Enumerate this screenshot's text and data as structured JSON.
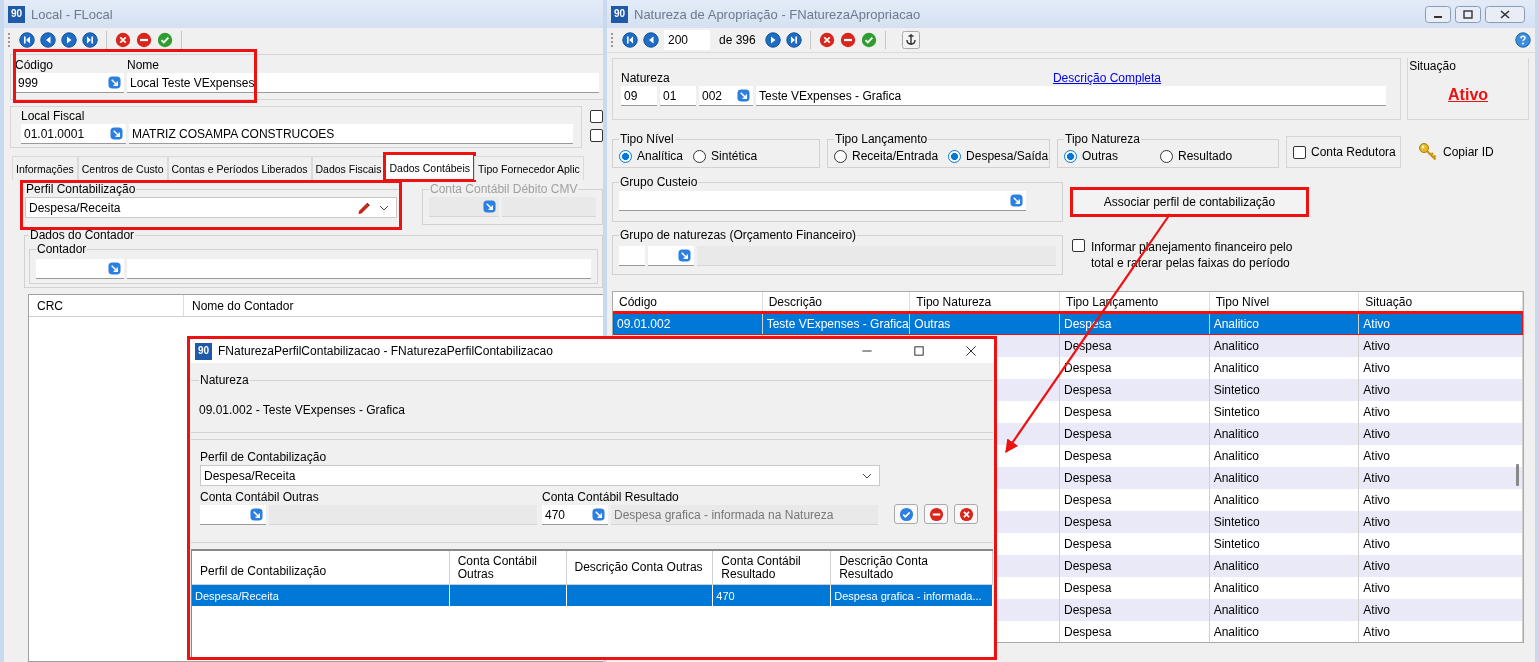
{
  "local_window": {
    "logo": "90",
    "title": "Local - FLocal",
    "codigo": {
      "label": "Código",
      "value": "999",
      "highlighted": true
    },
    "nome": {
      "label": "Nome",
      "value": "Local Teste VExpenses"
    },
    "local_fiscal": {
      "label": "Local Fiscal",
      "code": "01.01.0001",
      "name": "MATRIZ COSAMPA CONSTRUCOES"
    },
    "checkboxes": [
      {
        "checked": false
      },
      {
        "checked": false
      }
    ],
    "tabs": [
      {
        "label": "Informações",
        "selected": false,
        "highlighted": false
      },
      {
        "label": "Centros de Custo",
        "selected": false,
        "highlighted": false
      },
      {
        "label": "Contas e Períodos Liberados",
        "selected": false,
        "highlighted": false
      },
      {
        "label": "Dados Fiscais",
        "selected": false,
        "highlighted": false
      },
      {
        "label": "Dados Contábeis",
        "selected": true,
        "highlighted": true
      },
      {
        "label": "Tipo Fornecedor Aplic",
        "selected": false,
        "highlighted": false
      }
    ],
    "perfil": {
      "label": "Perfil Contabilização",
      "value": "Despesa/Receita",
      "highlighted": true
    },
    "conta_cmv": {
      "label": "Conta Contábil Débito CMV",
      "disabled": true
    },
    "dados_contador": {
      "label": "Dados do Contador",
      "contador_label": "Contador"
    },
    "grid_columns": [
      "CRC",
      "Nome do Contador"
    ]
  },
  "natureza_window": {
    "logo": "90",
    "title": "Natureza de Apropriação - FNaturezaApropriacao",
    "record": "200",
    "record_total": "de 396",
    "natureza": {
      "label": "Natureza",
      "parts": [
        "09",
        "01",
        "002"
      ],
      "description": "Teste VExpenses - Grafica",
      "link": "Descrição Completa"
    },
    "situacao": {
      "label": "Situação",
      "value": "Ativo"
    },
    "tipo_nivel": {
      "label": "Tipo Nível",
      "options": [
        {
          "label": "Analítica",
          "selected": true
        },
        {
          "label": "Sintética",
          "selected": false
        }
      ]
    },
    "tipo_lancamento": {
      "label": "Tipo Lançamento",
      "options": [
        {
          "label": "Receita/Entrada",
          "selected": false
        },
        {
          "label": "Despesa/Saída",
          "selected": true
        }
      ]
    },
    "tipo_natureza": {
      "label": "Tipo Natureza",
      "options": [
        {
          "label": "Outras",
          "selected": true
        },
        {
          "label": "Resultado",
          "selected": false
        }
      ]
    },
    "conta_redutora": {
      "label": "Conta Redutora",
      "checked": false
    },
    "copiar_id": "Copiar ID",
    "grupo_custeio": {
      "label": "Grupo Custeio"
    },
    "associar_button": {
      "label": "Associar perfil de contabilização",
      "highlighted": true
    },
    "grupo_naturezas": {
      "label": "Grupo de naturezas (Orçamento Financeiro)"
    },
    "informar": {
      "label": "Informar planejamento financeiro pelo total e raterar pelas faixas do período",
      "checked": false
    },
    "table": {
      "columns": [
        "Código",
        "Descrição",
        "Tipo Natureza",
        "Tipo Lançamento",
        "Tipo Nível",
        "Situação"
      ],
      "rows": [
        {
          "cells": [
            "09.01.002",
            "Teste VExpenses - Grafica",
            "Outras",
            "Despesa",
            "Analitico",
            "Ativo"
          ],
          "selected": true,
          "highlighted": true
        },
        {
          "cells": [
            "Despesa",
            "Analitico",
            "Ativo"
          ],
          "selected": false,
          "highlighted": false
        },
        {
          "cells": [
            "Despesa",
            "Analitico",
            "Ativo"
          ],
          "selected": false,
          "highlighted": false
        },
        {
          "cells": [
            "Despesa",
            "Sintetico",
            "Ativo"
          ],
          "selected": false,
          "highlighted": false
        },
        {
          "cells": [
            "Despesa",
            "Sintetico",
            "Ativo"
          ],
          "selected": false,
          "highlighted": false
        },
        {
          "cells": [
            "Despesa",
            "Analitico",
            "Ativo"
          ],
          "selected": false,
          "highlighted": false
        },
        {
          "cells": [
            "Despesa",
            "Analitico",
            "Ativo"
          ],
          "selected": false,
          "highlighted": false
        },
        {
          "cells": [
            "Despesa",
            "Analitico",
            "Ativo"
          ],
          "selected": false,
          "highlighted": false
        },
        {
          "cells": [
            "Despesa",
            "Analitico",
            "Ativo"
          ],
          "selected": false,
          "highlighted": false
        },
        {
          "cells": [
            "Despesa",
            "Sintetico",
            "Ativo"
          ],
          "selected": false,
          "highlighted": false
        },
        {
          "cells": [
            "Despesa",
            "Sintetico",
            "Ativo"
          ],
          "selected": false,
          "highlighted": false
        },
        {
          "cells": [
            "Despesa",
            "Analitico",
            "Ativo"
          ],
          "selected": false,
          "highlighted": false
        },
        {
          "cells": [
            "Despesa",
            "Analitico",
            "Ativo"
          ],
          "selected": false,
          "highlighted": false
        },
        {
          "cells": [
            "Despesa",
            "Analitico",
            "Ativo"
          ],
          "selected": false,
          "highlighted": false
        },
        {
          "cells": [
            "Despesa",
            "Analitico",
            "Ativo"
          ],
          "selected": false,
          "highlighted": false
        }
      ]
    }
  },
  "dialog": {
    "logo": "90",
    "title": "FNaturezaPerfilContabilizacao - FNaturezaPerfilContabilizacao",
    "highlighted": true,
    "natureza_label": "Natureza",
    "natureza_value": "09.01.002 - Teste VExpenses - Grafica",
    "perfil": {
      "label": "Perfil de Contabilização",
      "value": "Despesa/Receita"
    },
    "conta_outras": {
      "label": "Conta Contábil Outras"
    },
    "conta_resultado": {
      "label": "Conta Contábil Resultado",
      "value": "470",
      "description": "Despesa grafica - informada na Natureza"
    },
    "grid": {
      "columns": [
        "Perfil de Contabilização",
        "Conta Contábil Outras",
        "Descrição Conta Outras",
        "Conta Contábil Resultado",
        "Descrição Conta Resultado"
      ],
      "rows": [
        {
          "cells": [
            "Despesa/Receita",
            null,
            null,
            "470",
            "Despesa grafica - informada..."
          ],
          "selected": true
        }
      ]
    }
  }
}
